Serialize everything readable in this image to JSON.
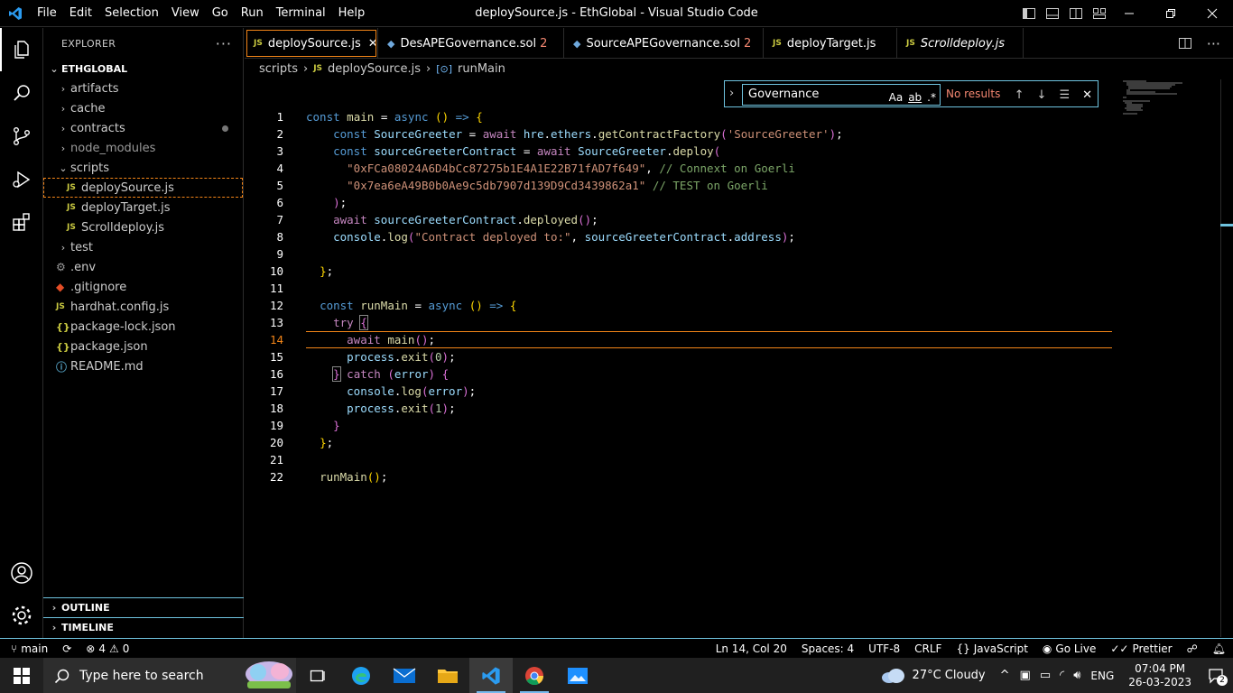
{
  "titlebar": {
    "menu": [
      "File",
      "Edit",
      "Selection",
      "View",
      "Go",
      "Run",
      "Terminal",
      "Help"
    ],
    "title": "deploySource.js - EthGlobal - Visual Studio Code"
  },
  "explorer": {
    "header": "EXPLORER",
    "root": "ETHGLOBAL",
    "items": [
      {
        "label": "artifacts"
      },
      {
        "label": "cache"
      },
      {
        "label": "contracts"
      },
      {
        "label": "node_modules"
      },
      {
        "label": "scripts"
      },
      {
        "label": "deploySource.js"
      },
      {
        "label": "deployTarget.js"
      },
      {
        "label": "Scrolldeploy.js"
      },
      {
        "label": "test"
      },
      {
        "label": ".env"
      },
      {
        "label": ".gitignore"
      },
      {
        "label": "hardhat.config.js"
      },
      {
        "label": "package-lock.json"
      },
      {
        "label": "package.json"
      },
      {
        "label": "README.md"
      }
    ],
    "outline": "OUTLINE",
    "timeline": "TIMELINE"
  },
  "tabs": [
    {
      "label": "deploySource.js",
      "badge": ""
    },
    {
      "label": "DesAPEGovernance.sol",
      "badge": "2"
    },
    {
      "label": "SourceAPEGovernance.sol",
      "badge": "2"
    },
    {
      "label": "deployTarget.js",
      "badge": ""
    },
    {
      "label": "Scrolldeploy.js",
      "badge": ""
    }
  ],
  "breadcrumb": {
    "folder": "scripts",
    "file": "deploySource.js",
    "symbol": "runMain"
  },
  "find": {
    "query": "Governance",
    "status": "No results",
    "opt_case": "Aa",
    "opt_word": "ab",
    "opt_regex": ".*"
  },
  "editor": {
    "line_numbers": [
      "1",
      "2",
      "3",
      "4",
      "5",
      "6",
      "7",
      "8",
      "9",
      "10",
      "11",
      "12",
      "13",
      "14",
      "15",
      "16",
      "17",
      "18",
      "19",
      "20",
      "21",
      "22"
    ],
    "current_line": 14
  },
  "statusbar": {
    "branch": "main",
    "errors": "4",
    "warnings": "0",
    "position": "Ln 14, Col 20",
    "spaces": "Spaces: 4",
    "encoding": "UTF-8",
    "eol": "CRLF",
    "language": "JavaScript",
    "golive": "Go Live",
    "prettier": "Prettier"
  },
  "taskbar": {
    "search_placeholder": "Type here to search",
    "weather": "27°C  Cloudy",
    "lang": "ENG",
    "time": "07:04 PM",
    "date": "26-03-2023",
    "notifications": "2"
  },
  "colors": {
    "accent": "#6fc3df",
    "focus": "#f38518",
    "keyword": "#569cd6",
    "string": "#ce9178",
    "function": "#dcdcaa",
    "variable": "#9cdcfe",
    "comment": "#7ca668"
  },
  "icons": [
    "vscode-logo-icon",
    "files-icon",
    "search-icon",
    "source-control-icon",
    "run-debug-icon",
    "extensions-icon",
    "account-icon",
    "settings-gear-icon"
  ]
}
